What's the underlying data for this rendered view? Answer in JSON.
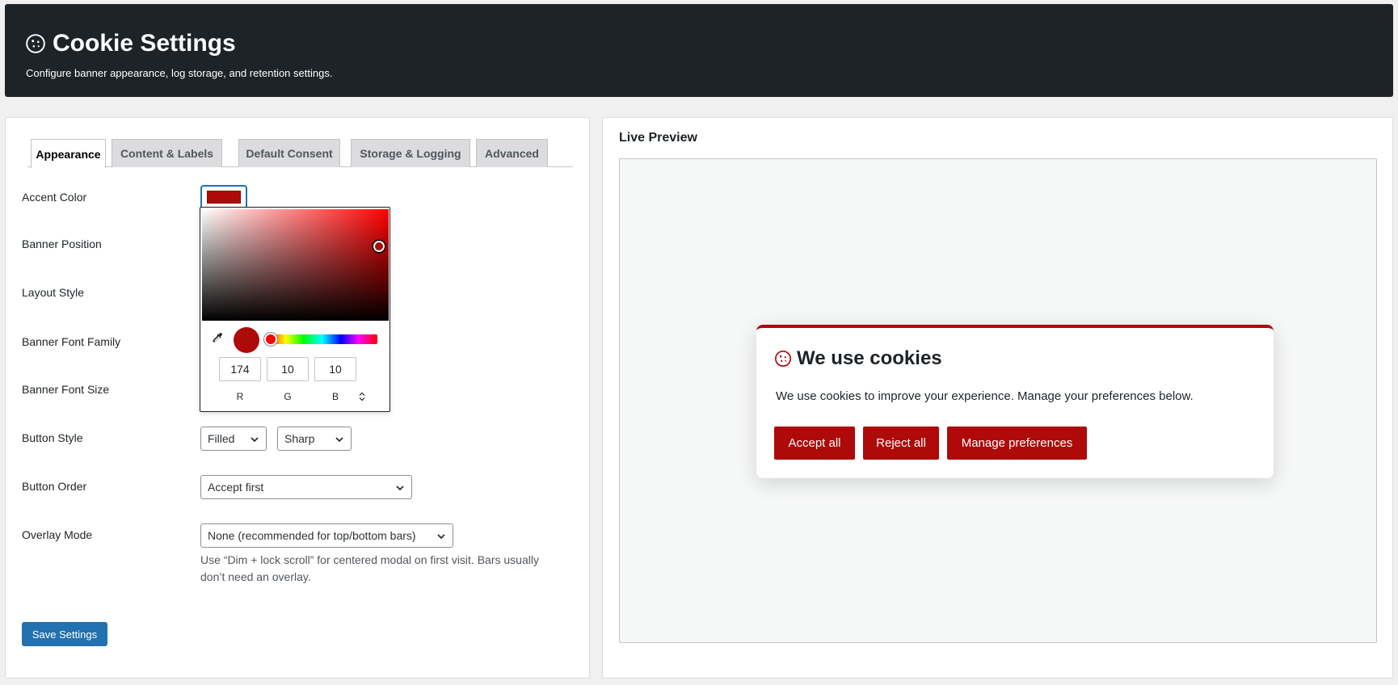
{
  "header": {
    "title": "Cookie Settings",
    "subtitle": "Configure banner appearance, log storage, and retention settings.",
    "icon": "cookie-icon"
  },
  "tabs": [
    {
      "label": "Appearance",
      "active": true
    },
    {
      "label": "Content & Labels",
      "active": false
    },
    {
      "label": "Default Consent",
      "active": false
    },
    {
      "label": "Storage & Logging",
      "active": false
    },
    {
      "label": "Advanced",
      "active": false
    }
  ],
  "fields": {
    "accent_color": {
      "label": "Accent Color",
      "value": "#ae0a0a"
    },
    "banner_position": {
      "label": "Banner Position"
    },
    "layout_style": {
      "label": "Layout Style"
    },
    "banner_font_family": {
      "label": "Banner Font Family"
    },
    "banner_font_size": {
      "label": "Banner Font Size"
    },
    "button_style": {
      "label": "Button Style",
      "fill_value": "Filled",
      "shape_value": "Sharp"
    },
    "button_order": {
      "label": "Button Order",
      "value": "Accept first"
    },
    "overlay_mode": {
      "label": "Overlay Mode",
      "value": "None (recommended for top/bottom bars)",
      "help": "Use “Dim + lock scroll” for centered modal on first visit. Bars usually don’t need an overlay."
    }
  },
  "color_picker": {
    "r": "174",
    "g": "10",
    "b": "10",
    "r_label": "R",
    "g_label": "G",
    "b_label": "B"
  },
  "save_button": "Save Settings",
  "preview": {
    "title": "Live Preview",
    "banner_title": "We use cookies",
    "banner_message": "We use cookies to improve your experience. Manage your preferences below.",
    "buttons": [
      "Accept all",
      "Reject all",
      "Manage preferences"
    ]
  },
  "colors": {
    "accent": "#ae0a0a",
    "header_bg": "#1d2327",
    "primary_button": "#2271b1"
  }
}
